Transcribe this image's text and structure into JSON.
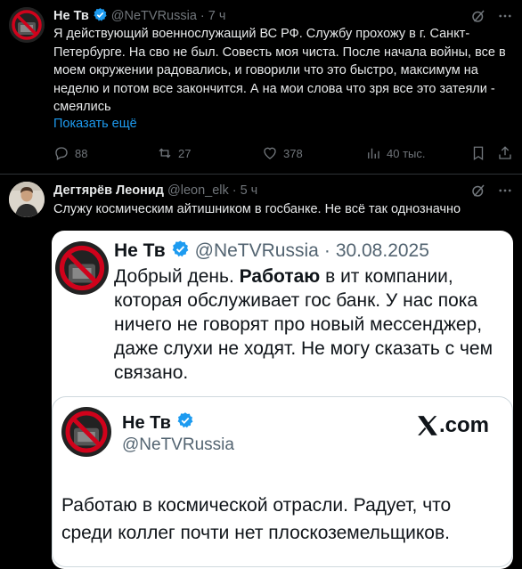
{
  "tweet1": {
    "name": "Не Тв",
    "handle": "@NeTVRussia",
    "sep": "·",
    "time": "7 ч",
    "text": "Я действующий военнослужащий ВС РФ. Службу прохожу в г. Санкт-Петербурге. На сво не был. Совесть моя чиста. После начала войны, все в моем окружении радовались, и говорили что это быстро, максимум на неделю и потом все закончится. А на мои слова что зря все это затеяли - смеялись",
    "show_more": "Показать ещё",
    "replies": "88",
    "reposts": "27",
    "likes": "378",
    "views": "40 тыс."
  },
  "tweet2": {
    "name": "Дегтярёв Леонид",
    "handle": "@leon_elk",
    "sep": "·",
    "time": "5 ч",
    "text": "Служу космическим айтишником в госбанке. Не всё так однозначно"
  },
  "embed": {
    "name": "Не Тв",
    "handle": "@NeTVRussia",
    "sep": "·",
    "date": "30.08.2025",
    "text_pre": "Добрый день. ",
    "text_bold": "Работаю",
    "text_post": " в ит компании, которая обслуживает гос банк. У нас пока ничего не говорят про новый мессенджер, даже слухи не ходят. Не могу сказать с чем связано.",
    "card": {
      "name": "Не Тв",
      "handle": "@NeTVRussia",
      "brand": ".com",
      "text": "Работаю в космической отрасли. Радует, что среди коллег почти нет плоскоземельщиков."
    }
  },
  "colors": {
    "accent": "#1d9bf0",
    "muted": "#71767b",
    "logo_red": "#d0021b"
  }
}
